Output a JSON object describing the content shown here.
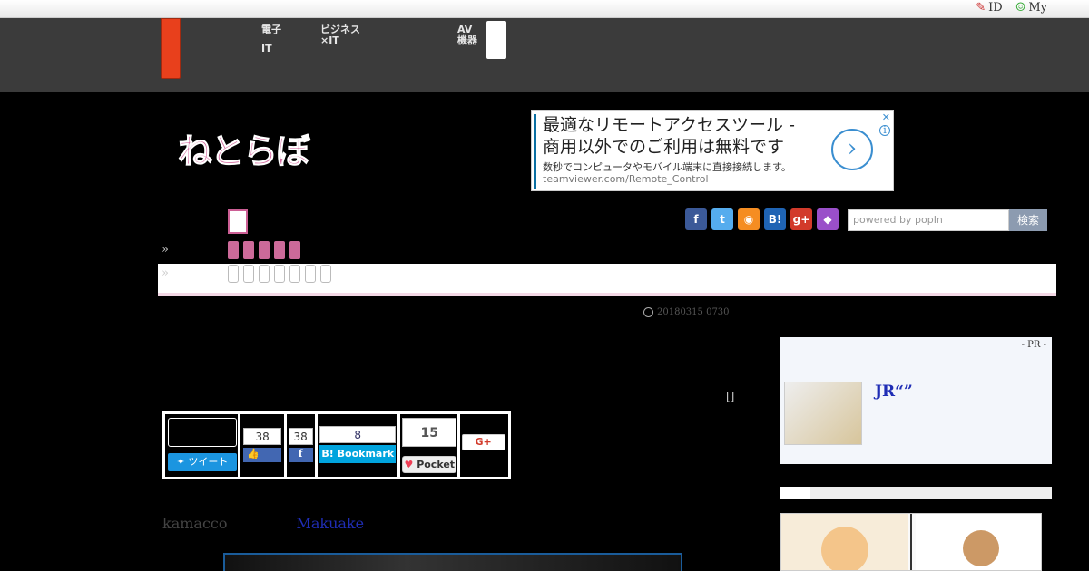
{
  "topbar": {
    "id_label": "ID",
    "my_label": "My"
  },
  "nav": {
    "item1": [
      "電子",
      "IT"
    ],
    "item2": [
      "ビジネス",
      "×IT"
    ],
    "item3": [
      "AV",
      "機器"
    ]
  },
  "logo": {
    "text": "ねとらぼ"
  },
  "ad": {
    "line1": "最適なリモートアクセスツール -",
    "line2": "商用以外でのご利用は無料です",
    "line3": "数秒でコンピュータやモバイル端末に直接接続します。",
    "url": "teamviewer.com/Remote_Control"
  },
  "social": [
    {
      "icon": "facebook-icon",
      "glyph": "f",
      "color": "#3b5998"
    },
    {
      "icon": "twitter-icon",
      "glyph": "t",
      "color": "#55acee"
    },
    {
      "icon": "rss-icon",
      "glyph": "◉",
      "color": "#f58d22"
    },
    {
      "icon": "hatena-icon",
      "glyph": "B!",
      "color": "#1f64b4"
    },
    {
      "icon": "googleplus-icon",
      "glyph": "g+",
      "color": "#d23a2a"
    },
    {
      "icon": "cat-icon",
      "glyph": "◆",
      "color": "#9a4fc9"
    }
  ],
  "search": {
    "placeholder": "powered by popIn",
    "button": "検索"
  },
  "breadcrumb": {
    "marker1": "»",
    "marker2": "»"
  },
  "article": {
    "date": "20180315 0730",
    "bracket": "[]"
  },
  "share": {
    "tweet_label": "ツイート",
    "like_count": "38",
    "fb_share_count": "38",
    "bookmark_count": "8",
    "bookmark_label": "B! Bookmark",
    "pocket_count": "15",
    "pocket_label": "Pocket",
    "gplus_label": "G+"
  },
  "pr": {
    "label": "- PR -",
    "title": "JR“”"
  },
  "byline": {
    "author": "kamacco",
    "link": "Makuake"
  }
}
